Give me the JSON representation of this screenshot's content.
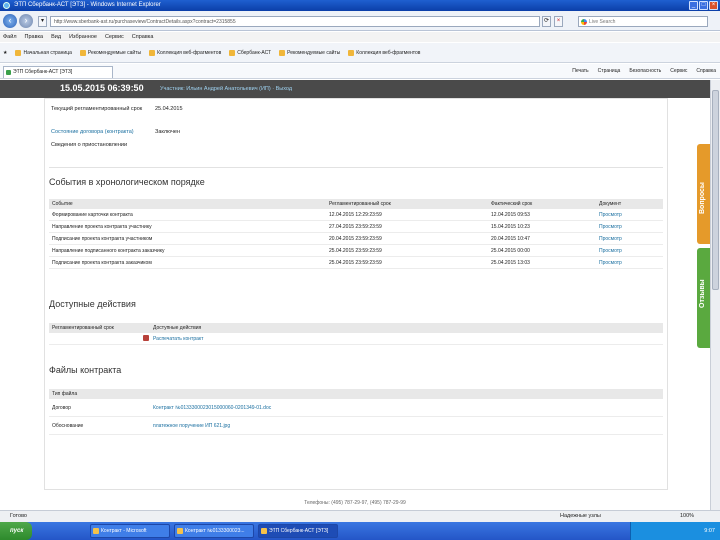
{
  "browser": {
    "title": "ЭТП Сбербанк-АСТ [ЭТЗ] - Windows Internet Explorer",
    "url": "http://www.sberbank-ast.ru/purchaseview/ContractDetails.aspx?contract=2315855",
    "search_placeholder": "Live Search",
    "menu": [
      "Файл",
      "Правка",
      "Вид",
      "Избранное",
      "Сервис",
      "Справка"
    ],
    "favorites": [
      "Начальная страница",
      "Рекомендуемые сайты",
      "Коллекция веб-фрагментов",
      "Сбербанк-АСТ",
      "Рекомендуемые сайты",
      "Коллекция веб-фрагментов"
    ],
    "tab_label": "ЭТП Сбербанк-АСТ [ЭТЗ]",
    "commands": [
      "Печать",
      "Страница",
      "Безопасность",
      "Сервис",
      "Справка"
    ]
  },
  "header": {
    "datetime": "15.05.2015 06:39:50",
    "user_line": "Участник: Ильин Андрей Анатольевич (ИП) · Выход"
  },
  "details": [
    {
      "key": "Текущий регламентированный срок",
      "value": "25.04.2015"
    },
    {
      "key": "Состояние договора (контракта)",
      "value": "Заключен"
    },
    {
      "key": "Сведения о приостановлении",
      "value": ""
    }
  ],
  "events": {
    "title": "События в хронологическом порядке",
    "headers": [
      "Событие",
      "Регламентированный срок",
      "Фактический срок",
      "Документ"
    ],
    "rows": [
      {
        "event": "Формирование карточки контракта",
        "reg": "12.04.2015 12:29:23:59",
        "fact": "12.04.2015 09:53",
        "doc": "Просмотр"
      },
      {
        "event": "Направление проекта контракта участнику",
        "reg": "27.04.2015 23:59:23:59",
        "fact": "15.04.2015 10:23",
        "doc": "Просмотр"
      },
      {
        "event": "Подписание проекта контракта участником",
        "reg": "20.04.2015 23:59:23:59",
        "fact": "20.04.2015 10:47",
        "doc": "Просмотр"
      },
      {
        "event": "Направление подписанного контракта заказчику",
        "reg": "25.04.2015 23:59:23:59",
        "fact": "25.04.2015 00:00",
        "doc": "Просмотр"
      },
      {
        "event": "Подписание проекта контракта заказчиком",
        "reg": "25.04.2015 23:59:23:59",
        "fact": "25.04.2015 13:03",
        "doc": "Просмотр"
      }
    ]
  },
  "actions": {
    "title": "Доступные действия",
    "headers": [
      "Регламентированный срок",
      "Доступные действия"
    ],
    "rows": [
      {
        "deadline": "",
        "action": "Распечатать контракт"
      }
    ]
  },
  "files": {
    "title": "Файлы контракта",
    "header": "Тип файла",
    "rows": [
      {
        "type": "Договор",
        "name": "Контракт №0133300023015000060-0201349-01.doc"
      },
      {
        "type": "Обоснование",
        "name": "платежное поручение ИП 621.jpg"
      }
    ]
  },
  "sidetabs": {
    "questions": "Вопросы",
    "feedback": "Отзывы"
  },
  "footer": "Телефоны: (495) 787-29-97, (495) 787-29-99",
  "status": {
    "left": "Готово",
    "zone": "Надежные узлы",
    "zoom": "100%"
  },
  "taskbar": {
    "start": "пуск",
    "buttons": [
      "Контракт - Microsoft",
      "Контракт №0133300023...",
      "ЭТП Сбербанк-АСТ [...",
      "ЭТП Сбербанк-АСТ [ЭТЗ]"
    ],
    "clock": "9:07"
  }
}
